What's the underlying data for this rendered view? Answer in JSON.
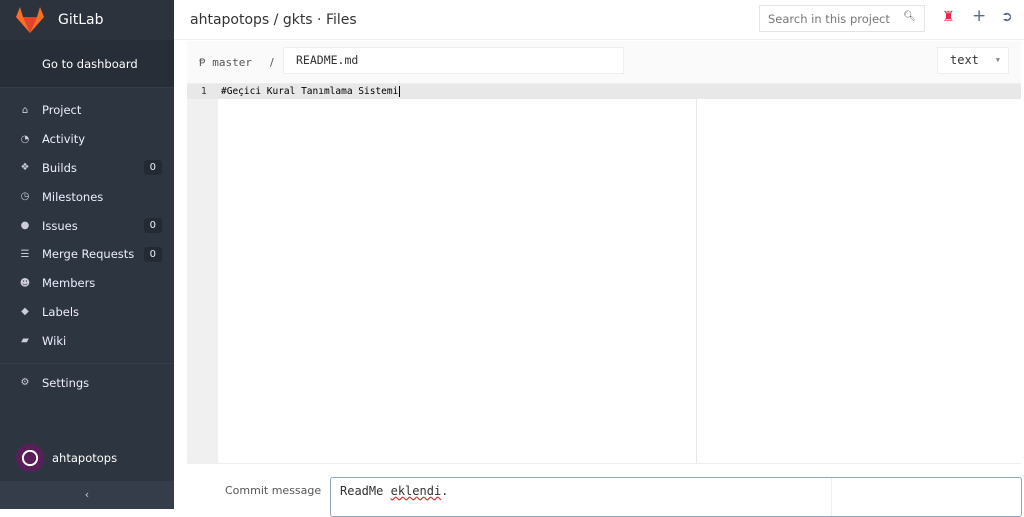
{
  "app": {
    "name": "GitLab",
    "dashboard": "Go to dashboard"
  },
  "sidebar": {
    "items": [
      {
        "label": "Project",
        "icon": "home-icon",
        "glyph": "⌂"
      },
      {
        "label": "Activity",
        "icon": "dashboard-icon",
        "glyph": "◔"
      },
      {
        "label": "Builds",
        "icon": "cubes-icon",
        "glyph": "❖",
        "badge": "0"
      },
      {
        "label": "Milestones",
        "icon": "clock-icon",
        "glyph": "◷"
      },
      {
        "label": "Issues",
        "icon": "exclamation-circle-icon",
        "glyph": "●",
        "badge": "0"
      },
      {
        "label": "Merge Requests",
        "icon": "list-icon",
        "glyph": "☰",
        "badge": "0"
      },
      {
        "label": "Members",
        "icon": "users-icon",
        "glyph": "☻"
      },
      {
        "label": "Labels",
        "icon": "tags-icon",
        "glyph": "◆"
      },
      {
        "label": "Wiki",
        "icon": "book-icon",
        "glyph": "▰"
      }
    ],
    "settings": {
      "label": "Settings",
      "icon": "cogs-icon",
      "glyph": "⚙"
    },
    "user": "ahtapotops",
    "collapse": "‹"
  },
  "header": {
    "title": "ahtapotops / gkts · Files",
    "search_placeholder": "Search in this project"
  },
  "editor": {
    "branch": "master",
    "separator": "/",
    "filename": "README.md",
    "mode": "text",
    "lines": [
      {
        "n": "1",
        "text": "#Geçici Kural Tanımlama Sistemi"
      }
    ]
  },
  "commit": {
    "label": "Commit message",
    "value_word1": "ReadMe",
    "value_word2": "eklendi",
    "value_end": "."
  },
  "colors": {
    "sidebar": "#2d3540",
    "accent": "#e8254f"
  }
}
